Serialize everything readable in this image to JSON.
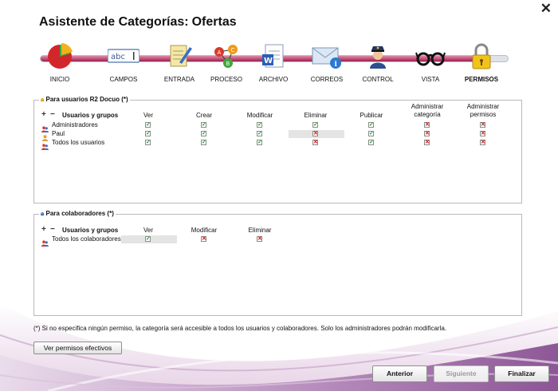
{
  "window": {
    "title_prefix": "Asistente de Categorías:",
    "title_name": "Ofertas",
    "close_glyph": "✕"
  },
  "steps": [
    {
      "label": "INICIO",
      "icon": "pie-chart-icon"
    },
    {
      "label": "CAMPOS",
      "icon": "text-field-icon"
    },
    {
      "label": "ENTRADA",
      "icon": "edit-document-icon"
    },
    {
      "label": "PROCESO",
      "icon": "process-circles-icon"
    },
    {
      "label": "ARCHIVO",
      "icon": "word-document-icon"
    },
    {
      "label": "CORREOS",
      "icon": "mail-icon"
    },
    {
      "label": "CONTROL",
      "icon": "police-officer-icon"
    },
    {
      "label": "VISTA",
      "icon": "glasses-icon"
    },
    {
      "label": "PERMISOS",
      "icon": "padlock-icon",
      "active": true
    }
  ],
  "progress": {
    "current_step": 9,
    "total_steps": 9
  },
  "users_panel": {
    "legend": "Para usuarios R2 Docuo (*)",
    "col_users": "Usuarios y grupos",
    "add_glyph": "+",
    "remove_glyph": "−",
    "columns": [
      "Ver",
      "Crear",
      "Modificar",
      "Eliminar",
      "Publicar",
      "Administrar categoría",
      "Administrar permisos"
    ],
    "rows": [
      {
        "name": "Administradores",
        "icon": "user-group-icon",
        "perms": [
          true,
          true,
          true,
          true,
          true,
          false,
          false
        ]
      },
      {
        "name": "Paul",
        "icon": "user-icon",
        "perms": [
          true,
          true,
          true,
          false,
          true,
          false,
          false
        ]
      },
      {
        "name": "Todos los usuarios",
        "icon": "user-group-icon",
        "perms": [
          true,
          true,
          true,
          false,
          true,
          false,
          false
        ]
      }
    ]
  },
  "collab_panel": {
    "legend": "Para colaboradores (*)",
    "col_users": "Usuarios y grupos",
    "add_glyph": "+",
    "remove_glyph": "−",
    "columns": [
      "Ver",
      "Modificar",
      "Eliminar"
    ],
    "rows": [
      {
        "name": "Todos los colaboradores",
        "icon": "user-group-icon",
        "perms": [
          true,
          false,
          false
        ]
      }
    ]
  },
  "note": "(*) Si no especifica ningún permiso, la categoría será accesible a todos los usuarios y colaboradores. Solo los administradores podrán modificarla.",
  "buttons": {
    "effective": "Ver permisos efectivos",
    "prev": "Anterior",
    "next": "Siguiente",
    "finish": "Finalizar"
  },
  "colors": {
    "accent": "#8a1a4d",
    "check": "#1f9a2a",
    "cross": "#cc1111"
  }
}
